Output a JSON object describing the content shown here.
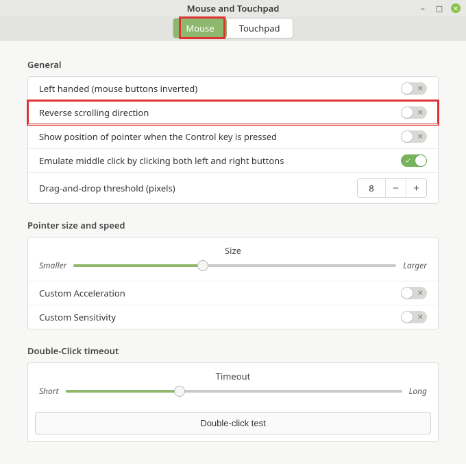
{
  "window": {
    "title": "Mouse and Touchpad"
  },
  "tabs": {
    "mouse": "Mouse",
    "touchpad": "Touchpad",
    "active": "mouse"
  },
  "sections": {
    "general": {
      "title": "General",
      "left_handed": {
        "label": "Left handed (mouse buttons inverted)",
        "value": false
      },
      "reverse_scroll": {
        "label": "Reverse scrolling direction",
        "value": false,
        "highlighted": true
      },
      "show_position": {
        "label": "Show position of pointer when the Control key is pressed",
        "value": false
      },
      "emulate_middle": {
        "label": "Emulate middle click by clicking both left and right buttons",
        "value": true
      },
      "drag_threshold": {
        "label": "Drag-and-drop threshold (pixels)",
        "value": "8"
      }
    },
    "pointer": {
      "title": "Pointer size and speed",
      "size": {
        "title": "Size",
        "left": "Smaller",
        "right": "Larger",
        "percent": 40
      },
      "custom_acceleration": {
        "label": "Custom Acceleration",
        "value": false
      },
      "custom_sensitivity": {
        "label": "Custom Sensitivity",
        "value": false
      }
    },
    "doubleclick": {
      "title": "Double-Click timeout",
      "timeout": {
        "title": "Timeout",
        "left": "Short",
        "right": "Long",
        "percent": 34
      },
      "test_button": "Double-click test"
    }
  }
}
